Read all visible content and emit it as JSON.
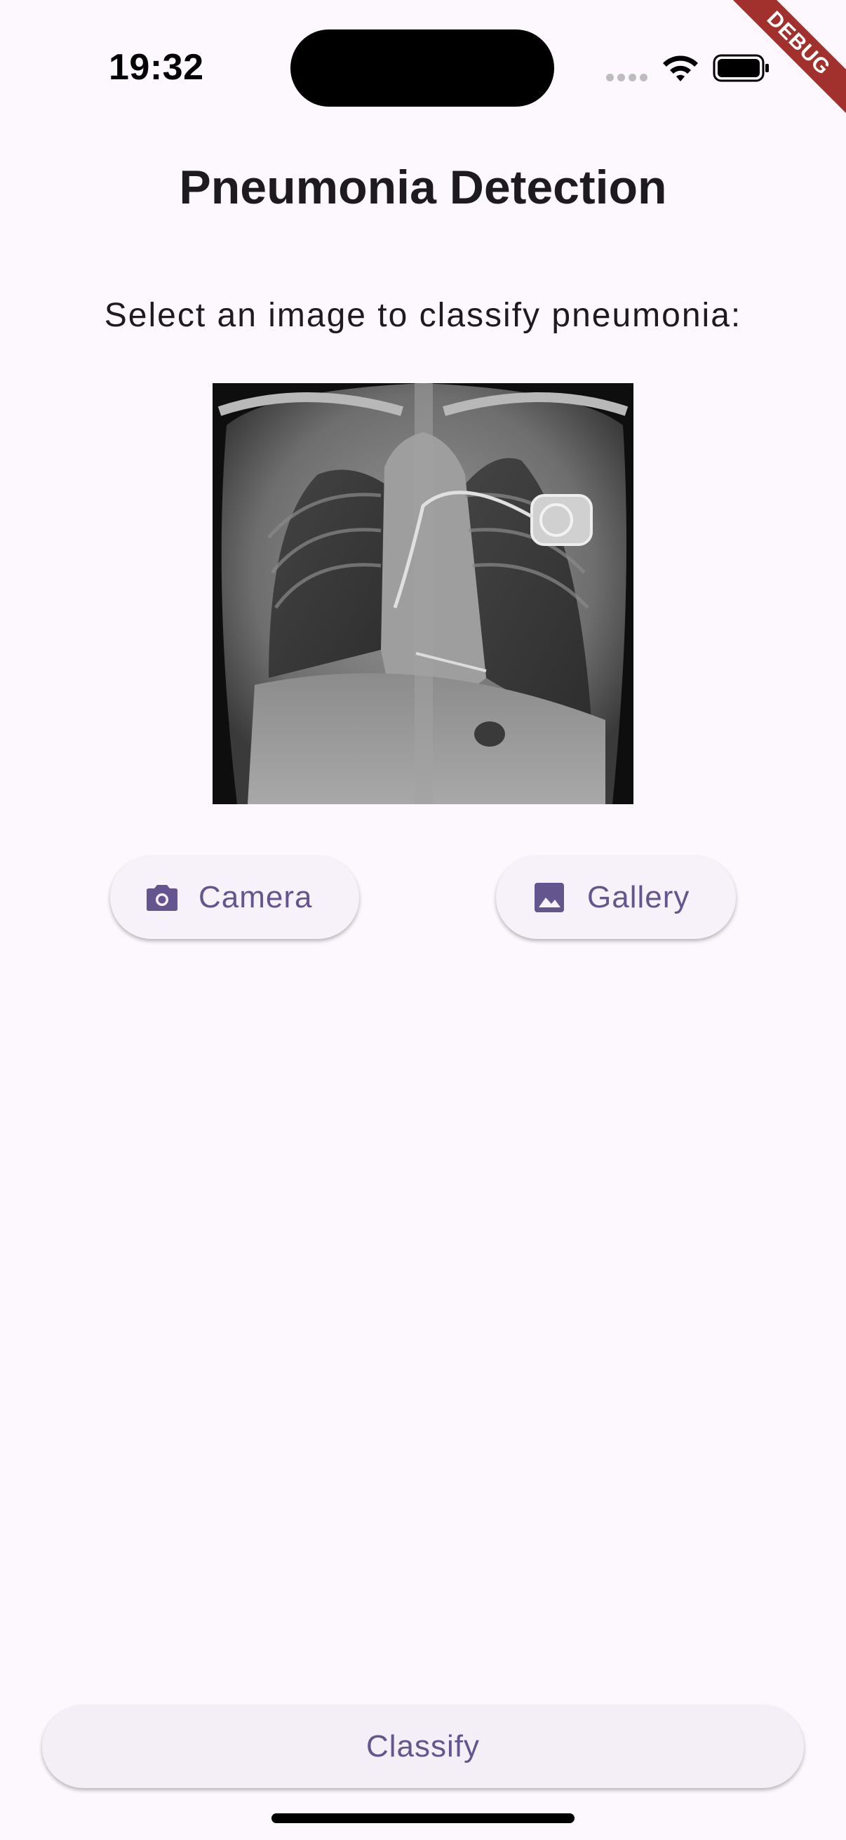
{
  "status_bar": {
    "time": "19:32"
  },
  "debug_banner": "DEBUG",
  "header": {
    "title": "Pneumonia Detection"
  },
  "main": {
    "instruction": "Select an image to classify pneumonia:",
    "buttons": {
      "camera_label": "Camera",
      "gallery_label": "Gallery"
    },
    "classify_label": "Classify"
  },
  "colors": {
    "background": "#fdf7fe",
    "accent": "#65558f",
    "button_surface": "#f7f2fa",
    "debug_banner": "#a2302d"
  },
  "icons": {
    "camera": "camera-icon",
    "gallery": "image-icon"
  }
}
